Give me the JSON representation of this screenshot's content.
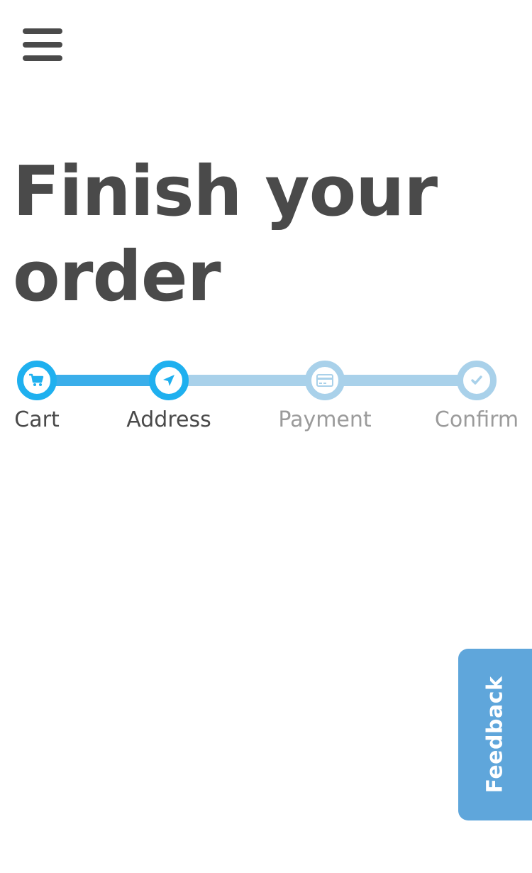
{
  "header": {
    "menu_icon": "hamburger-menu-icon"
  },
  "main": {
    "title": "Finish your order"
  },
  "stepper": {
    "colors": {
      "active": "#1fb0ef",
      "pending": "#a9d1ea",
      "progress_line": "#3aaeea"
    },
    "steps": [
      {
        "label": "Cart",
        "icon": "cart-icon",
        "state": "completed"
      },
      {
        "label": "Address",
        "icon": "location-arrow-icon",
        "state": "current"
      },
      {
        "label": "Payment",
        "icon": "credit-card-icon",
        "state": "pending"
      },
      {
        "label": "Confirm",
        "icon": "check-icon",
        "state": "pending"
      }
    ]
  },
  "feedback": {
    "label": "Feedback",
    "color": "#5fa6db"
  }
}
